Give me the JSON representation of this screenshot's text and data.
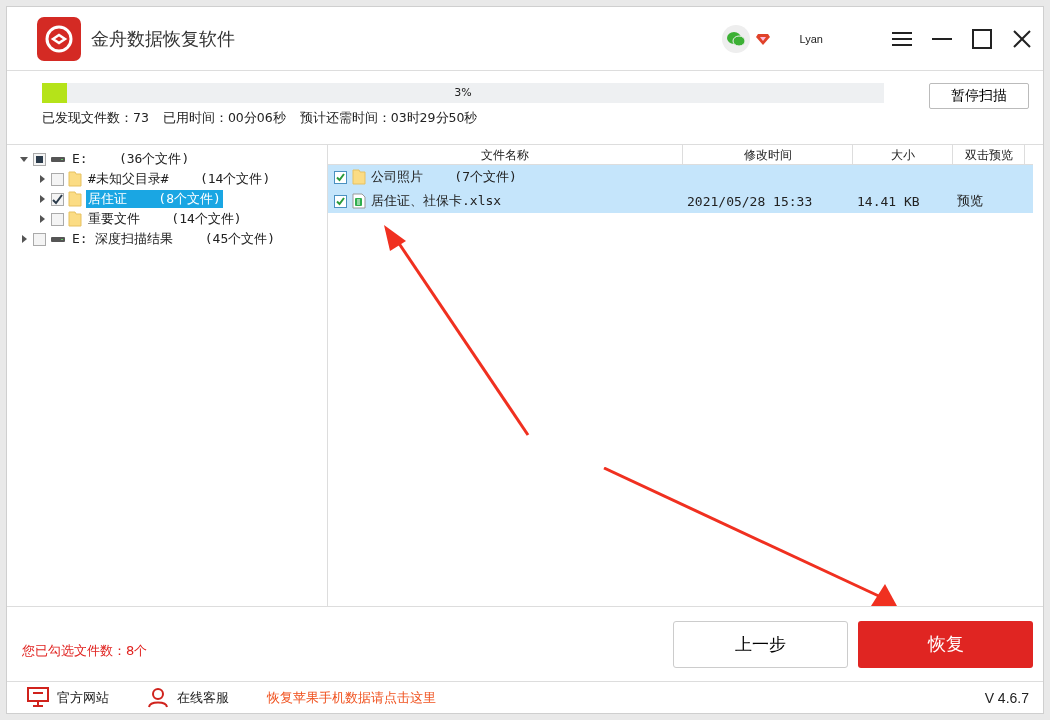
{
  "window": {
    "title": "金舟数据恢复软件",
    "user": "Lyan"
  },
  "scan": {
    "level": 0.03,
    "percent": "3%",
    "button": "暂停扫描",
    "stats": [
      "已发现文件数：73",
      "已用时间：00分06秒",
      "预计还需时间：03时29分50秒"
    ]
  },
  "tree": [
    {
      "kind": "drive",
      "label": "E:",
      "count": "(36个文件)",
      "expanded": true,
      "checked": false,
      "mixed": true,
      "selected": false,
      "children": [
        {
          "kind": "folder",
          "label": "#未知父目录#",
          "count": "(14个文件)",
          "expanded": false,
          "checked": false,
          "selected": false
        },
        {
          "kind": "folder",
          "label": "居住证",
          "count": "(8个文件)",
          "expanded": false,
          "checked": true,
          "selected": true
        },
        {
          "kind": "folder",
          "label": "重要文件",
          "count": "(14个文件)",
          "expanded": false,
          "checked": false,
          "selected": false
        }
      ]
    },
    {
      "kind": "drive",
      "label": "E: 深度扫描结果",
      "count": "(45个文件)",
      "expanded": false,
      "checked": false,
      "selected": false
    }
  ],
  "table": {
    "columns": [
      "文件名称",
      "修改时间",
      "大小",
      "双击预览"
    ],
    "rows": [
      {
        "kind": "folder",
        "name": "公司照片",
        "count": "(7个文件)",
        "checked": true,
        "selected": true
      },
      {
        "kind": "spreadsheet",
        "name": "居住证、社保卡.xlsx",
        "modified": "2021/05/28 15:33",
        "size": "14.41 KB",
        "preview": "预览",
        "checked": true,
        "selected": true
      }
    ]
  },
  "selection_summary": "您已勾选文件数：8个",
  "buttons": {
    "back": "上一步",
    "recover": "恢复"
  },
  "footer": {
    "links": [
      {
        "kind": "website",
        "label": "官方网站"
      },
      {
        "kind": "support",
        "label": "在线客服"
      }
    ],
    "promo": "恢复苹果手机数据请点击这里",
    "version": "V 4.6.7"
  }
}
